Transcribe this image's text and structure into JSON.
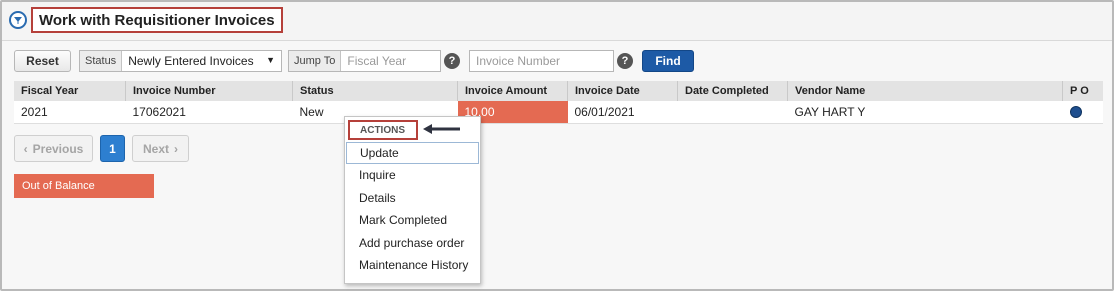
{
  "page": {
    "title": "Work with Requisitioner Invoices"
  },
  "toolbar": {
    "reset_label": "Reset",
    "status_label": "Status",
    "status_value": "Newly Entered Invoices",
    "jump_to_label": "Jump To",
    "fiscal_year_placeholder": "Fiscal Year",
    "invoice_number_placeholder": "Invoice Number",
    "help_glyph": "?",
    "find_label": "Find"
  },
  "table": {
    "columns": [
      "Fiscal Year",
      "Invoice Number",
      "Status",
      "Invoice Amount",
      "Invoice Date",
      "Date Completed",
      "Vendor Name",
      "P O"
    ],
    "rows": [
      {
        "fiscal_year": "2021",
        "invoice_number": "17062021",
        "status": "New",
        "invoice_amount": "10.00",
        "invoice_date": "06/01/2021",
        "date_completed": "",
        "vendor_name": "GAY HART Y",
        "po_icon": "info-icon"
      }
    ]
  },
  "pager": {
    "previous_label": "Previous",
    "current_page": "1",
    "next_label": "Next"
  },
  "legend": {
    "out_of_balance_label": "Out of Balance"
  },
  "actions_menu": {
    "header": "ACTIONS",
    "items": [
      "Update",
      "Inquire",
      "Details",
      "Mark Completed",
      "Add purchase order",
      "Maintenance History"
    ],
    "selected_index": 0
  },
  "colors": {
    "accent_blue": "#1d5aa6",
    "highlight_red": "#b5403a",
    "out_of_balance": "#e46a52",
    "page_active": "#2d7fd0"
  }
}
